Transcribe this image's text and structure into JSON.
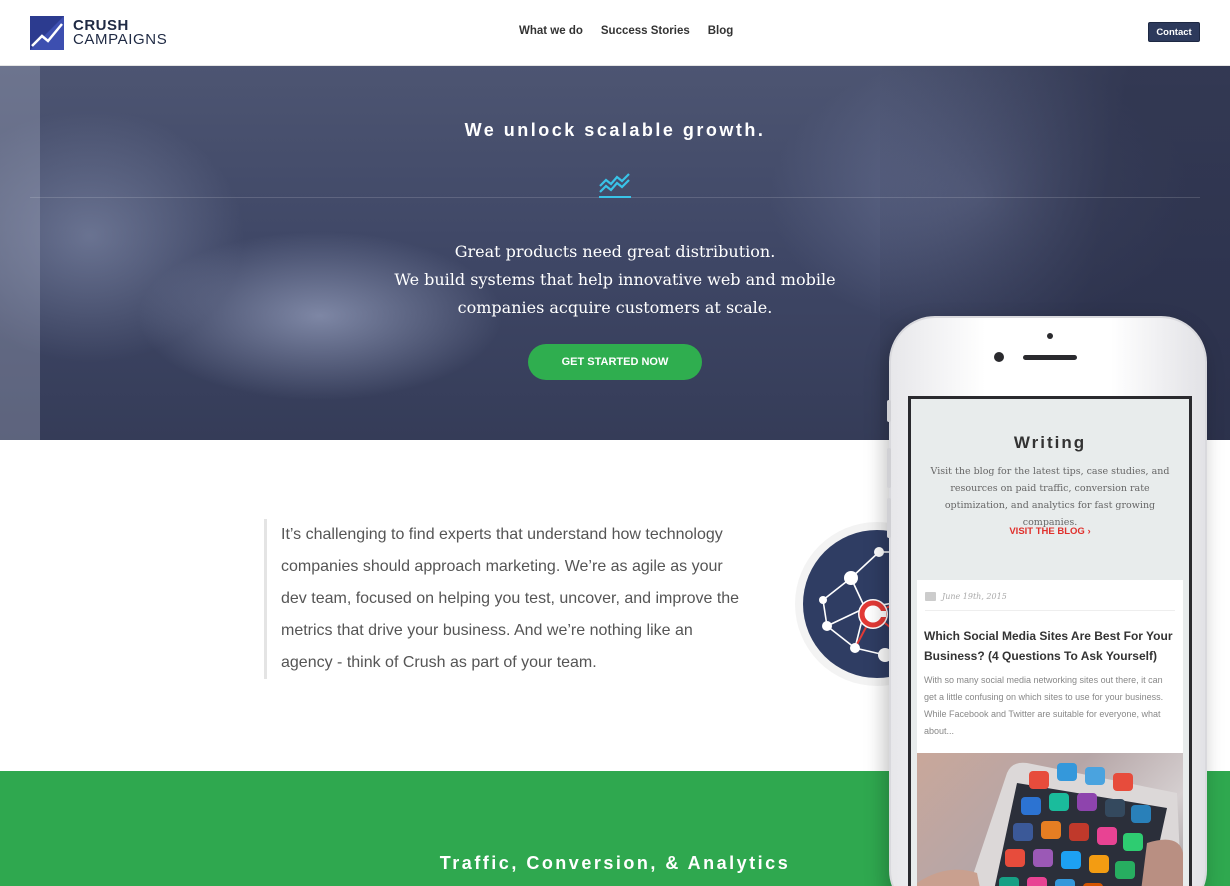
{
  "header": {
    "logo": {
      "line1": "CRUSH",
      "line2": "CAMPAIGNS"
    },
    "nav": [
      {
        "label": "What we do"
      },
      {
        "label": "Success Stories"
      },
      {
        "label": "Blog"
      }
    ],
    "contact_label": "Contact"
  },
  "hero": {
    "title": "We unlock scalable growth.",
    "icon": "trend-chart-icon",
    "copy_line1": "Great products need great distribution.",
    "copy_line2": "We build systems that help innovative web and mobile",
    "copy_line3": "companies acquire customers at scale.",
    "cta_label": "GET STARTED NOW"
  },
  "intro": {
    "text": "It’s challenging to find experts that understand how technology companies should approach marketing. We’re as agile as your dev team, focused on helping you test, uncover, and improve the metrics that drive your business. And we’re nothing like an agency - think of Crush as part of your team."
  },
  "phone": {
    "writing_title": "Writing",
    "writing_desc": "Visit the blog for the latest tips, case studies, and resources on paid traffic, conversion rate optimization, and analytics for fast growing companies.",
    "visit_label": "VISIT THE BLOG",
    "post": {
      "date": "June 19th, 2015",
      "title": "Which Social Media Sites Are Best For Your Business? (4 Questions To Ask Yourself)",
      "excerpt": "With so many social media networking sites out there, it can get a little confusing on which sites to use for your business. While Facebook and Twitter are suitable for everyone, what about..."
    }
  },
  "green_band": {
    "title": "Traffic, Conversion, & Analytics"
  },
  "colors": {
    "brand_navy": "#2c3b8f",
    "cta_green": "#2fae4f",
    "band_green": "#2fa84f",
    "accent_red": "#e0302c",
    "accent_cyan": "#39c3e8"
  }
}
